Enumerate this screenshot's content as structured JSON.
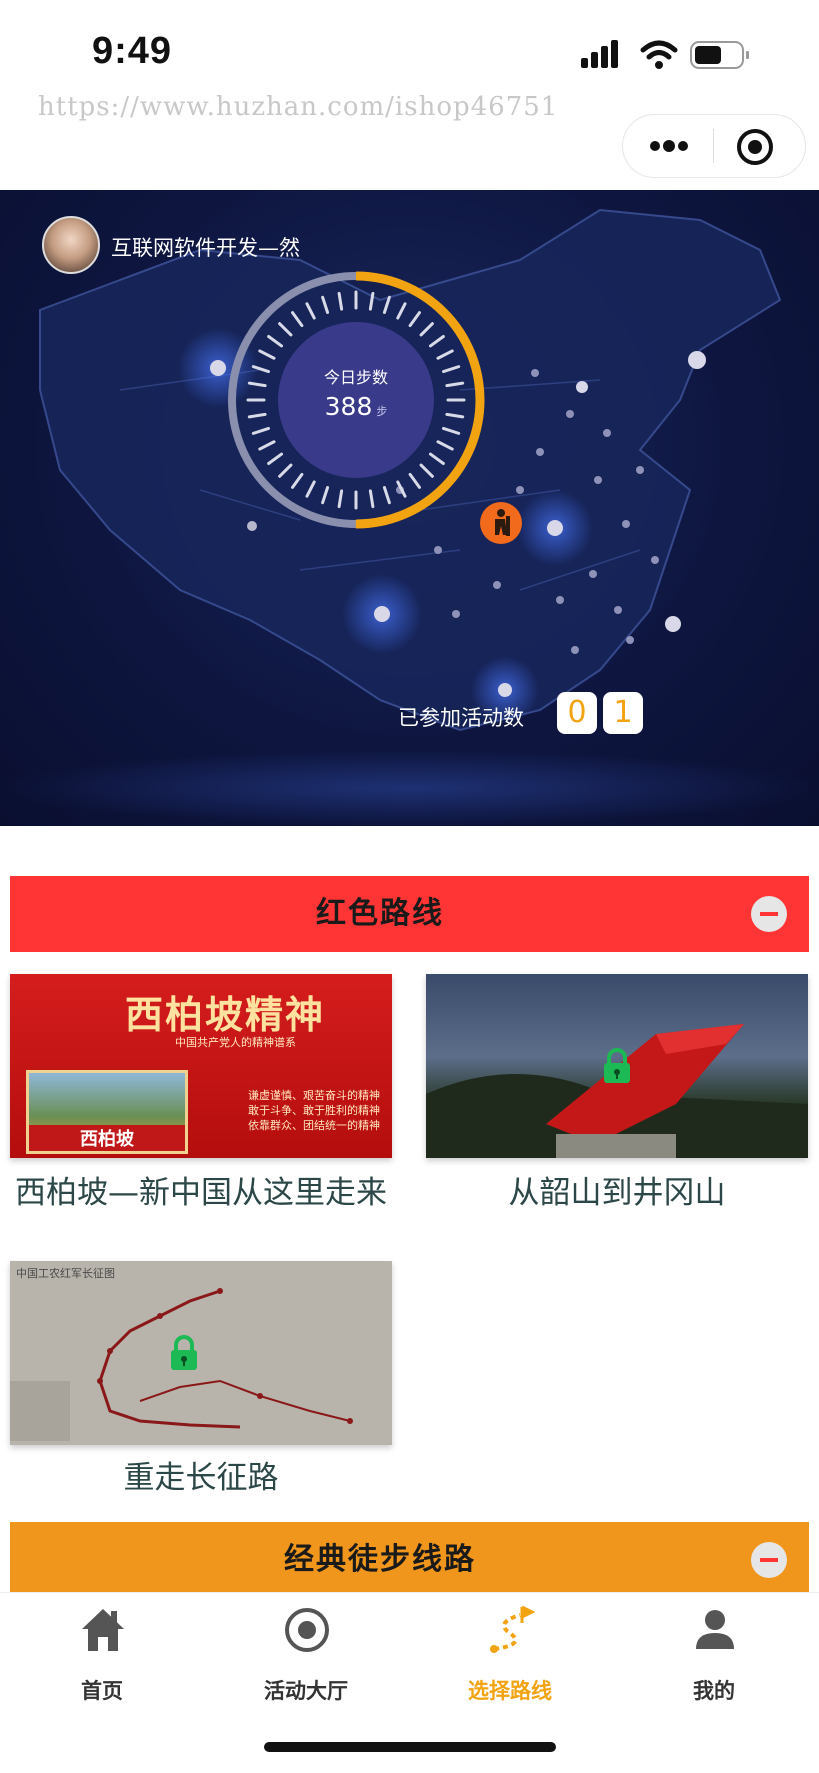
{
  "status": {
    "time": "9:49"
  },
  "watermark": "https://www.huzhan.com/ishop46751",
  "capsule": {
    "more_icon": "more-dots-icon",
    "close_icon": "target-close-icon"
  },
  "profile": {
    "username": "互联网软件开发—然"
  },
  "steps": {
    "label": "今日步数",
    "value": "388",
    "unit": "步",
    "progress": 0.5
  },
  "activities": {
    "label": "已参加活动数",
    "digits": [
      "0",
      "1"
    ]
  },
  "sections": [
    {
      "title": "红色路线",
      "color": "#ff3535"
    },
    {
      "title": "经典徒步线路",
      "color": "#f0961c"
    }
  ],
  "routes": [
    {
      "title": "西柏坡—新中国从这里走来",
      "thumb_title": "西柏坡精神",
      "thumb_subtitle": "中国共产党人的精神谱系",
      "thumb_lines": [
        "谦虚谨慎、艰苦奋斗的精神",
        "敢于斗争、敢于胜利的精神",
        "依靠群众、团结统一的精神"
      ],
      "thumb_tag": "西柏坡",
      "locked": false
    },
    {
      "title": "从韶山到井冈山",
      "locked": true
    },
    {
      "title": "重走长征路",
      "thumb_title": "中国工农红军长征图",
      "locked": true
    }
  ],
  "tabs": [
    {
      "label": "首页",
      "icon": "home-icon",
      "active": false
    },
    {
      "label": "活动大厅",
      "icon": "target-icon",
      "active": false
    },
    {
      "label": "选择路线",
      "icon": "route-icon",
      "active": true
    },
    {
      "label": "我的",
      "icon": "user-icon",
      "active": false
    }
  ],
  "colors": {
    "accent": "#f2a312",
    "red": "#ff3535",
    "orange": "#f0961c",
    "lock_green": "#1db954"
  }
}
